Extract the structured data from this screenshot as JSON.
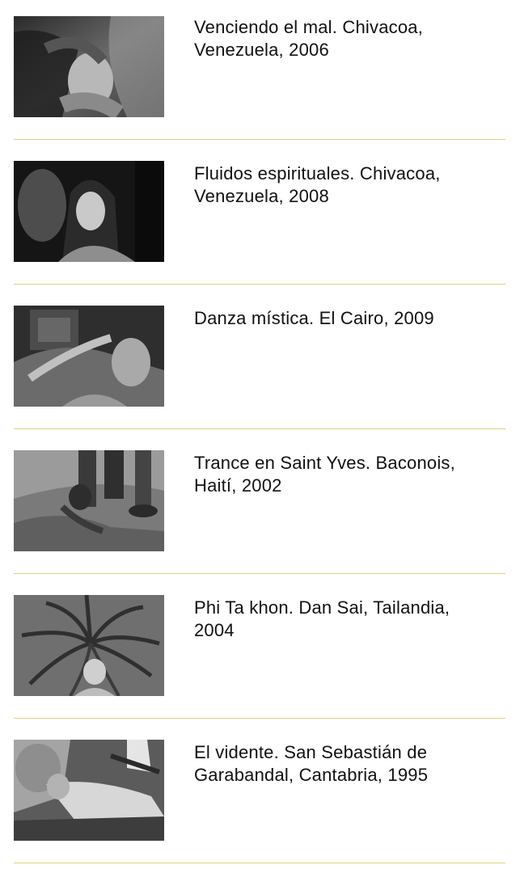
{
  "gallery": {
    "items": [
      {
        "caption": "Venciendo el mal. Chivacoa, Venezuela, 2006",
        "photo": "photo-woman-water-ritual"
      },
      {
        "caption": "Fluidos espirituales. Chivacoa, Venezuela, 2008",
        "photo": "photo-woman-in-trance"
      },
      {
        "caption": "Danza mística. El Cairo, 2009",
        "photo": "photo-mystic-dance"
      },
      {
        "caption": "Trance en Saint Yves. Baconois, Haití, 2002",
        "photo": "photo-man-on-ground"
      },
      {
        "caption": "Phi Ta khon. Dan Sai, Tailandia, 2004",
        "photo": "photo-tree-roots"
      },
      {
        "caption": "El vidente. San Sebastián de Garabandal, Cantabria, 1995",
        "photo": "photo-seer-lying"
      }
    ],
    "divider_color": "#e5cf7e"
  }
}
